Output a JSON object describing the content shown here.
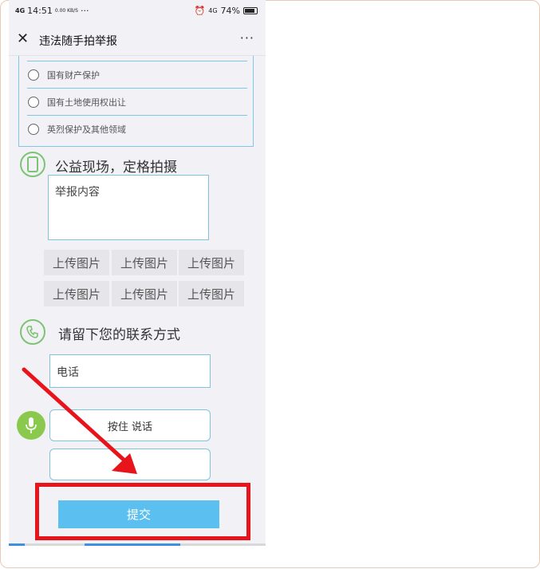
{
  "status_bar": {
    "signal": "4G",
    "time": "14:51",
    "speed": "0.00 KB/S",
    "dots": "···",
    "network": "4G",
    "battery": "74%"
  },
  "nav": {
    "close_icon": "close-icon",
    "title": "违法随手拍举报",
    "more": "···"
  },
  "options": [
    {
      "label": "国有财产保护"
    },
    {
      "label": "国有土地使用权出让"
    },
    {
      "label": "英烈保护及其他领域"
    }
  ],
  "section_photo": {
    "icon": "phone-icon",
    "title": "公益现场，定格拍摄",
    "report_placeholder": "举报内容",
    "uploads": [
      "上传图片",
      "上传图片",
      "上传图片",
      "上传图片",
      "上传图片",
      "上传图片"
    ]
  },
  "section_contact": {
    "icon": "telephone-icon",
    "title": "请留下您的联系方式",
    "phone_placeholder": "电话"
  },
  "voice": {
    "icon": "microphone-icon",
    "hold_label": "按住 说话",
    "playback_icon": "speaker-icon"
  },
  "submit_label": "提交",
  "colors": {
    "accent_blue": "#5bbff0",
    "border_blue": "#80c3dd",
    "green": "#7cc474",
    "annotation_red": "#e8141b"
  }
}
